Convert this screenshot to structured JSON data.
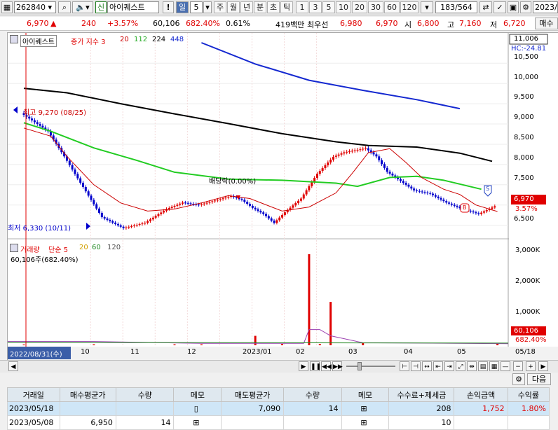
{
  "toolbar": {
    "code": "262840",
    "stock_name": "아이퀘스트",
    "new_badge": "신",
    "alert_mark": "!",
    "period_day": "일",
    "period_num": "5",
    "period_buttons": [
      "주",
      "월",
      "년",
      "분",
      "초",
      "틱"
    ],
    "interval_buttons": [
      "1",
      "3",
      "5",
      "10",
      "20",
      "30",
      "60",
      "120"
    ],
    "page_count": "183/564",
    "date_cut": "2023/0"
  },
  "quote": {
    "price": "6,970",
    "change": "240",
    "change_pct": "+3.57%",
    "volume": "60,106",
    "volume_ratio": "682.40%",
    "turnover": "0.61%",
    "amount": "419백만",
    "best_label": "최우선",
    "bid1": "6,980",
    "ask1": "6,970",
    "open_label": "시",
    "open": "6,800",
    "high_label": "고",
    "high": "7,160",
    "low_label": "저",
    "low": "6,720",
    "trade_btn": "매수"
  },
  "price_panel": {
    "legend_name": "아이퀘스트",
    "legend_rest": "종가 지수 3",
    "ma20": "20",
    "ma112": "112",
    "ma224": "224",
    "ma448": "448",
    "axis_top": "11,006",
    "hc_label": "HC:-24.81",
    "ticks": [
      "10,500",
      "10,000",
      "9,500",
      "9,000",
      "8,500",
      "8,000",
      "7,500",
      "7,000",
      "6,500"
    ],
    "current_price": "6,970",
    "current_pct": "3.57%",
    "high_note": "최고 9,270 (08/25)",
    "low_note": "최저 6,330 (10/11)",
    "dividend_note": "배당락(0.00%)",
    "sell_marker": "S",
    "buy_marker": "B"
  },
  "volume_panel": {
    "legend_title": "거래량",
    "legend_rest": "단순 5",
    "ma20": "20",
    "ma60": "60",
    "ma120": "120",
    "summary": "60,106주(682.40%)",
    "ticks": [
      "3,000K",
      "2,000K",
      "1,000K"
    ],
    "current_vol": "60,106",
    "current_pct": "682.40%"
  },
  "x_axis": {
    "start_date": "2022/08/31(수)",
    "months": [
      "10",
      "11",
      "12",
      "2023/01",
      "02",
      "03",
      "04",
      "05"
    ],
    "end_date": "05/18"
  },
  "table": {
    "buttons": {
      "next": "다음"
    },
    "headers": [
      "거래일",
      "매수평균가",
      "수량",
      "메모",
      "매도평균가",
      "수량",
      "메모",
      "수수료+제세금",
      "손익금액",
      "수익률"
    ],
    "rows": [
      [
        "2023/05/18",
        "",
        "",
        "",
        "7,090",
        "14",
        "",
        "208",
        "1,752",
        "1.80%"
      ],
      [
        "2023/05/08",
        "6,950",
        "14",
        "",
        "",
        "",
        "",
        "10",
        "",
        ""
      ]
    ]
  },
  "colors": {
    "up": "#e00000",
    "down": "#0000cc",
    "ma20": "#cc0000",
    "ma112": "#22cc22",
    "ma224": "#000000",
    "ma448": "#1428d0"
  },
  "chart_data": {
    "type": "candlestick",
    "price_range": [
      6200,
      11006
    ],
    "volume_range": [
      0,
      3300000
    ],
    "ma448": [
      [
        0,
        11006
      ],
      [
        10,
        10480
      ],
      [
        20,
        10080
      ],
      [
        30,
        9830
      ],
      [
        40,
        9600
      ],
      [
        48,
        9380
      ]
    ],
    "ma224": [
      [
        -33,
        9880
      ],
      [
        -25,
        9770
      ],
      [
        -15,
        9500
      ],
      [
        -5,
        9250
      ],
      [
        5,
        9010
      ],
      [
        15,
        8760
      ],
      [
        25,
        8560
      ],
      [
        31,
        8470
      ],
      [
        40,
        8430
      ],
      [
        48,
        8280
      ],
      [
        54,
        8080
      ]
    ],
    "ma112": [
      [
        -33,
        9030
      ],
      [
        -28,
        8820
      ],
      [
        -20,
        8410
      ],
      [
        -12,
        8100
      ],
      [
        -5,
        7810
      ],
      [
        5,
        7640
      ],
      [
        15,
        7610
      ],
      [
        25,
        7540
      ],
      [
        29,
        7460
      ],
      [
        35,
        7680
      ],
      [
        40,
        7710
      ],
      [
        45,
        7610
      ],
      [
        52,
        7390
      ]
    ],
    "ma20": [
      [
        -33,
        8900
      ],
      [
        -28,
        8700
      ],
      [
        -25,
        8200
      ],
      [
        -20,
        7500
      ],
      [
        -15,
        7050
      ],
      [
        -10,
        6850
      ],
      [
        -5,
        6900
      ],
      [
        0,
        7050
      ],
      [
        5,
        7230
      ],
      [
        9,
        7160
      ],
      [
        15,
        6850
      ],
      [
        20,
        6950
      ],
      [
        25,
        7300
      ],
      [
        28,
        7780
      ],
      [
        31,
        8290
      ],
      [
        35,
        8390
      ],
      [
        38,
        8050
      ],
      [
        41,
        7670
      ],
      [
        45,
        7390
      ],
      [
        48,
        7260
      ],
      [
        51,
        7000
      ],
      [
        55,
        6840
      ]
    ],
    "closes": [
      [
        -33,
        9270
      ],
      [
        -28,
        8820
      ],
      [
        -25,
        8200
      ],
      [
        -22,
        7550
      ],
      [
        -18,
        6700
      ],
      [
        -14,
        6430
      ],
      [
        -10,
        6560
      ],
      [
        -6,
        6900
      ],
      [
        -3,
        7060
      ],
      [
        0,
        7000
      ],
      [
        3,
        7110
      ],
      [
        6,
        7220
      ],
      [
        8,
        7130
      ],
      [
        10,
        6930
      ],
      [
        12,
        6780
      ],
      [
        14,
        6560
      ],
      [
        16,
        6820
      ],
      [
        19,
        7160
      ],
      [
        22,
        7770
      ],
      [
        25,
        8190
      ],
      [
        27,
        8300
      ],
      [
        29,
        8350
      ],
      [
        31,
        8400
      ],
      [
        33,
        8200
      ],
      [
        35,
        7820
      ],
      [
        37,
        7640
      ],
      [
        40,
        7360
      ],
      [
        43,
        7280
      ],
      [
        46,
        7060
      ],
      [
        49,
        6900
      ],
      [
        52,
        6780
      ],
      [
        55,
        6970
      ]
    ],
    "volumes": [
      [
        -33,
        25000
      ],
      [
        -20,
        30000
      ],
      [
        -5,
        30000
      ],
      [
        0,
        30000
      ],
      [
        10,
        300000
      ],
      [
        15,
        40000
      ],
      [
        20,
        2900000
      ],
      [
        22,
        40000
      ],
      [
        24,
        1380000
      ],
      [
        30,
        80000
      ],
      [
        55,
        60106
      ]
    ]
  }
}
